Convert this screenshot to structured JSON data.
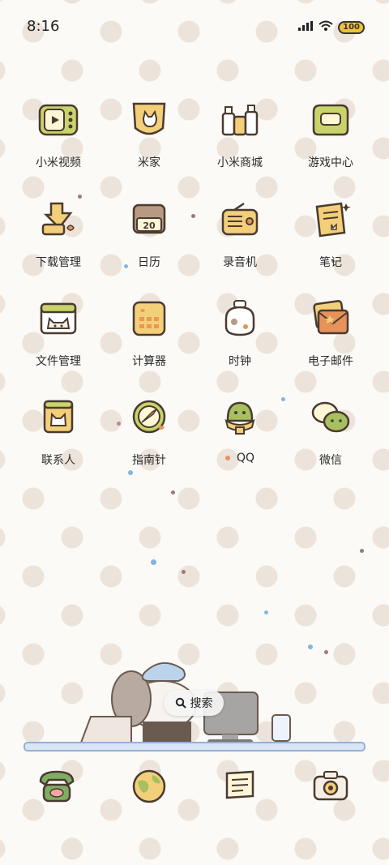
{
  "status": {
    "time": "8:16",
    "battery": "100"
  },
  "apps": [
    {
      "label": "小米视频",
      "icon": "tv-icon"
    },
    {
      "label": "米家",
      "icon": "cat-shield-icon"
    },
    {
      "label": "小米商城",
      "icon": "bottles-icon"
    },
    {
      "label": "游戏中心",
      "icon": "gamepad-icon"
    },
    {
      "label": "下载管理",
      "icon": "download-box-icon"
    },
    {
      "label": "日历",
      "icon": "calendar-icon",
      "day": "20"
    },
    {
      "label": "录音机",
      "icon": "radio-icon"
    },
    {
      "label": "笔记",
      "icon": "notepad-icon"
    },
    {
      "label": "文件管理",
      "icon": "folder-cat-icon"
    },
    {
      "label": "计算器",
      "icon": "calculator-icon"
    },
    {
      "label": "时钟",
      "icon": "clock-bag-icon"
    },
    {
      "label": "电子邮件",
      "icon": "envelope-icon"
    },
    {
      "label": "联系人",
      "icon": "contact-card-icon"
    },
    {
      "label": "指南针",
      "icon": "compass-icon"
    },
    {
      "label": "QQ",
      "icon": "qq-penguin-icon"
    },
    {
      "label": "微信",
      "icon": "wechat-bubbles-icon"
    }
  ],
  "search": {
    "label": "搜索"
  },
  "dock": [
    {
      "name": "phone",
      "icon": "phone-icon"
    },
    {
      "name": "browser",
      "icon": "globe-icon"
    },
    {
      "name": "messages",
      "icon": "message-icon"
    },
    {
      "name": "camera",
      "icon": "camera-icon"
    }
  ]
}
